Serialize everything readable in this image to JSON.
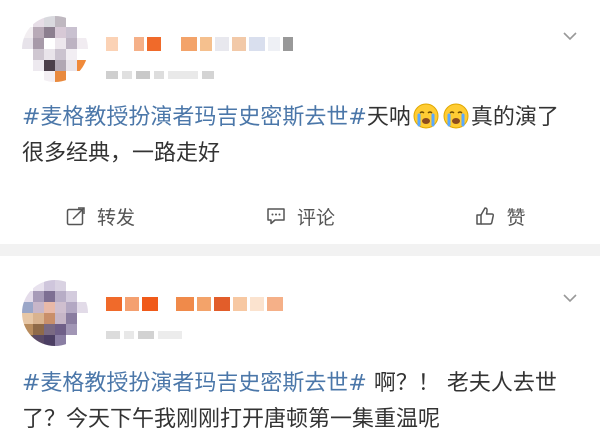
{
  "colors": {
    "topic": "#4b77a9",
    "text": "#333333",
    "action": "#555555",
    "divider": "#f2f2f2"
  },
  "posts": [
    {
      "topic": "#麦格教授扮演者玛吉史密斯去世#",
      "text_before_emoji": "天呐",
      "emoji": [
        "crying-face-emoji",
        "crying-face-emoji"
      ],
      "text_after_emoji": "真的演了很多经典，一路走好",
      "actions": {
        "repost_label": "转发",
        "comment_label": "评论",
        "like_label": "赞"
      }
    },
    {
      "topic": "#麦格教授扮演者玛吉史密斯去世#",
      "text": " 啊？！ 老夫人去世了？今天下午我刚刚打开唐顿第一集重温呢"
    }
  ]
}
